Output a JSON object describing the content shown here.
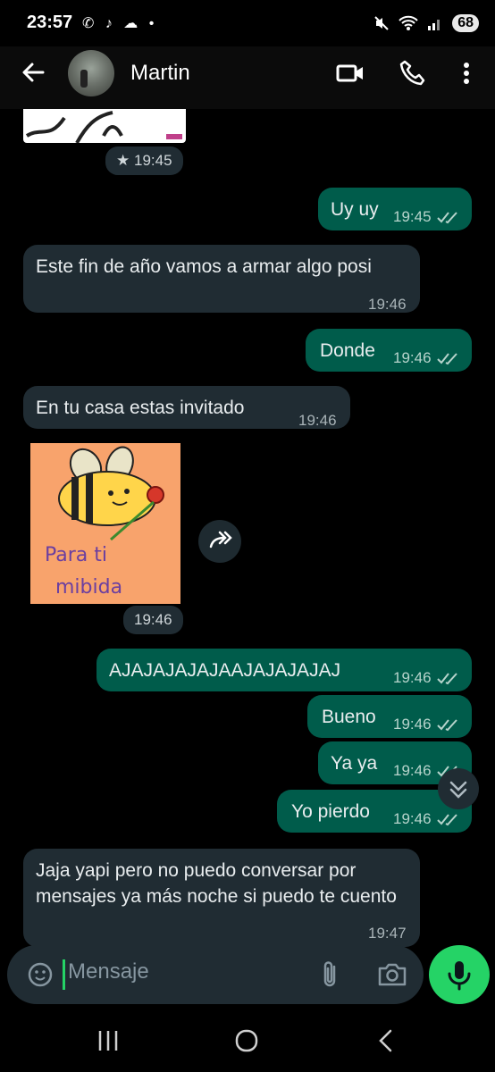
{
  "status": {
    "time": "23:57",
    "battery": "68",
    "status_icons": "✆ ♪ ☁ •"
  },
  "header": {
    "contact_name": "Martin"
  },
  "messages": [
    {
      "dir": "in",
      "kind": "image-partial",
      "time": "19:45",
      "starred": true
    },
    {
      "dir": "out",
      "text": "Uy uy",
      "time": "19:45"
    },
    {
      "dir": "in",
      "text": "Este fin de año vamos a armar algo posi",
      "time": "19:46"
    },
    {
      "dir": "out",
      "text": "Donde",
      "time": "19:46"
    },
    {
      "dir": "in",
      "text": "En tu casa estas invitado",
      "time": "19:46"
    },
    {
      "dir": "in",
      "kind": "sticker",
      "sticker_text": "Para ti mibida",
      "time": "19:46"
    },
    {
      "dir": "out",
      "text": "AJAJAJAJAJAAJAJAJAJAJ",
      "time": "19:46"
    },
    {
      "dir": "out",
      "text": "Bueno",
      "time": "19:46"
    },
    {
      "dir": "out",
      "text": "Ya ya",
      "time": "19:46"
    },
    {
      "dir": "out",
      "text": "Yo pierdo",
      "time": "19:46"
    },
    {
      "dir": "in",
      "text": "Jaja yapi pero no puedo conversar por mensajes ya más noche si puedo te cuento",
      "time": "19:47"
    }
  ],
  "sticker": {
    "line1": "Para ti",
    "line2": "mibida"
  },
  "input": {
    "placeholder": "Mensaje"
  },
  "colors": {
    "incoming": "#202c33",
    "outgoing": "#005c4b",
    "accent": "#25d366",
    "background": "#000000"
  }
}
